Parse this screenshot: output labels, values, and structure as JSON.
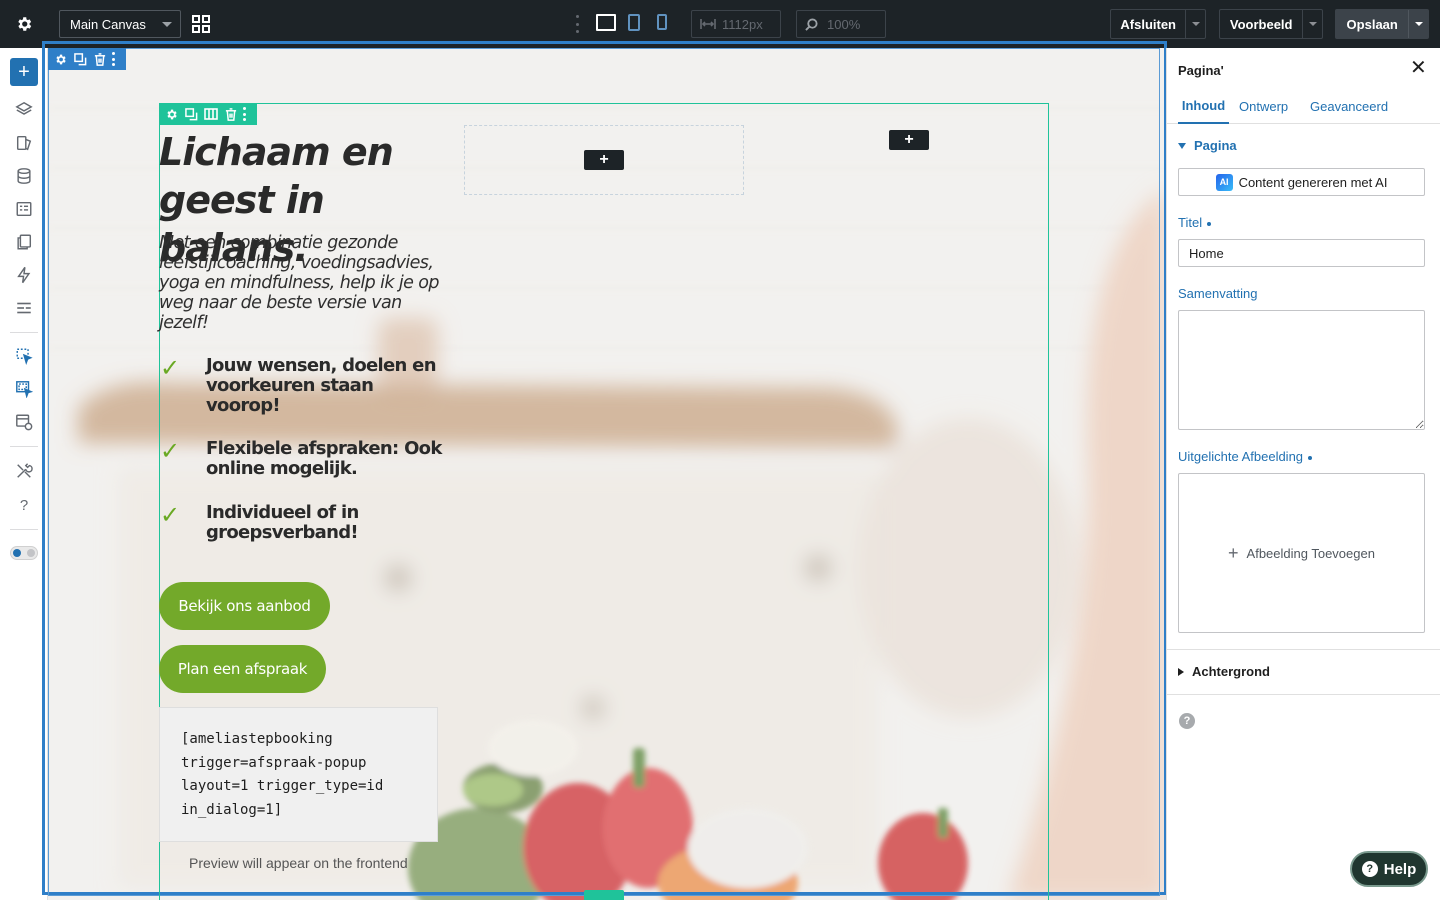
{
  "topbar": {
    "canvas_select": "Main Canvas",
    "width_value": "1112px",
    "zoom_value": "100%",
    "close_label": "Afsluiten",
    "preview_label": "Voorbeeld",
    "save_label": "Opslaan"
  },
  "icons": {
    "settings": "gear-icon",
    "grid": "grid-icon",
    "desktop": "desktop-icon",
    "tablet": "tablet-icon",
    "mobile": "mobile-icon",
    "width": "arrows-horizontal-icon",
    "zoom": "search-icon"
  },
  "canvas": {
    "hero_title_line1": "Lichaam en",
    "hero_title_line2": "geest in balans.",
    "hero_subtitle": "Met een combinatie gezonde leefstijlcoaching, voedingsadvies, yoga en mindfulness, help ik je op weg naar de beste versie van jezelf!",
    "checklist": [
      "Jouw wensen, doelen en voorkeuren staan voorop!",
      "Flexibele afspraken: Ook online mogelijk.",
      "Individueel of in groepsverband!"
    ],
    "cta_primary": "Bekijk ons aanbod",
    "cta_secondary": "Plan een afspraak",
    "shortcode_lines": [
      "[ameliastepbooking",
      "trigger=afspraak-popup",
      "layout=1 trigger_type=id",
      "in_dialog=1]"
    ],
    "preview_note": "Preview will appear on the frontend"
  },
  "panel": {
    "title": "Pagina'",
    "tabs": [
      "Inhoud",
      "Ontwerp",
      "Geavanceerd"
    ],
    "section_open": "Pagina",
    "ai_button": "Content genereren met AI",
    "ai_badge": "AI",
    "title_label": "Titel",
    "title_value": "Home",
    "summary_label": "Samenvatting",
    "summary_value": "",
    "featured_label": "Uitgelichte Afbeelding",
    "add_image": "Afbeelding Toevoegen",
    "section_closed": "Achtergrond"
  },
  "help": {
    "label": "Help"
  },
  "colors": {
    "topbar": "#1d2327",
    "accent_blue": "#2271b1",
    "section_green": "#1fc39a",
    "cta_green": "#73a92a",
    "check_green": "#6aa924"
  }
}
